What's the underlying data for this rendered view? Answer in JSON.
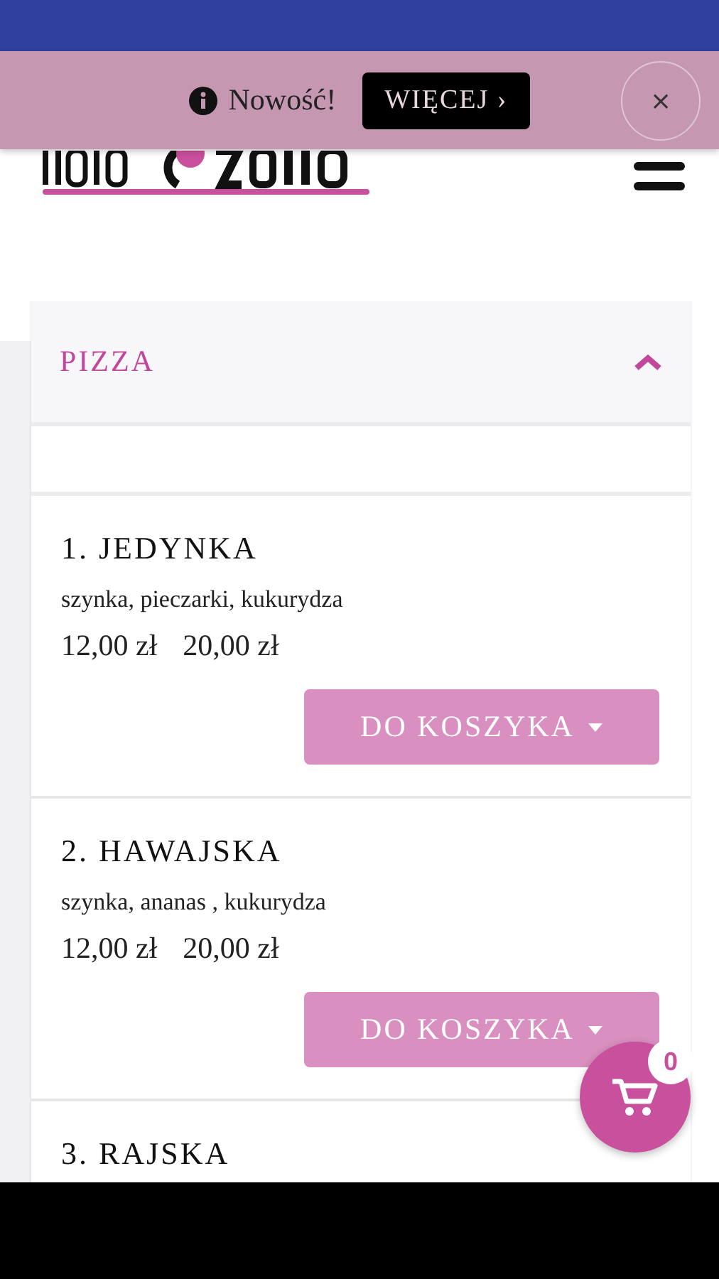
{
  "notice": {
    "text": "Nowość!",
    "button": "WIĘCEJ ›",
    "close": "×"
  },
  "category": {
    "title": "PIZZA",
    "expanded": true
  },
  "items": [
    {
      "name": "1. JEDYNKA",
      "ingredients": "szynka, pieczarki, kukurydza",
      "prices": [
        "12,00 zł",
        "20,00 zł"
      ],
      "button": "DO KOSZYKA"
    },
    {
      "name": "2. HAWAJSKA",
      "ingredients": "szynka, ananas , kukurydza",
      "prices": [
        "12,00 zł",
        "20,00 zł"
      ],
      "button": "DO KOSZYKA"
    },
    {
      "name": "3. RAJSKA"
    }
  ],
  "cart": {
    "count": "0"
  }
}
